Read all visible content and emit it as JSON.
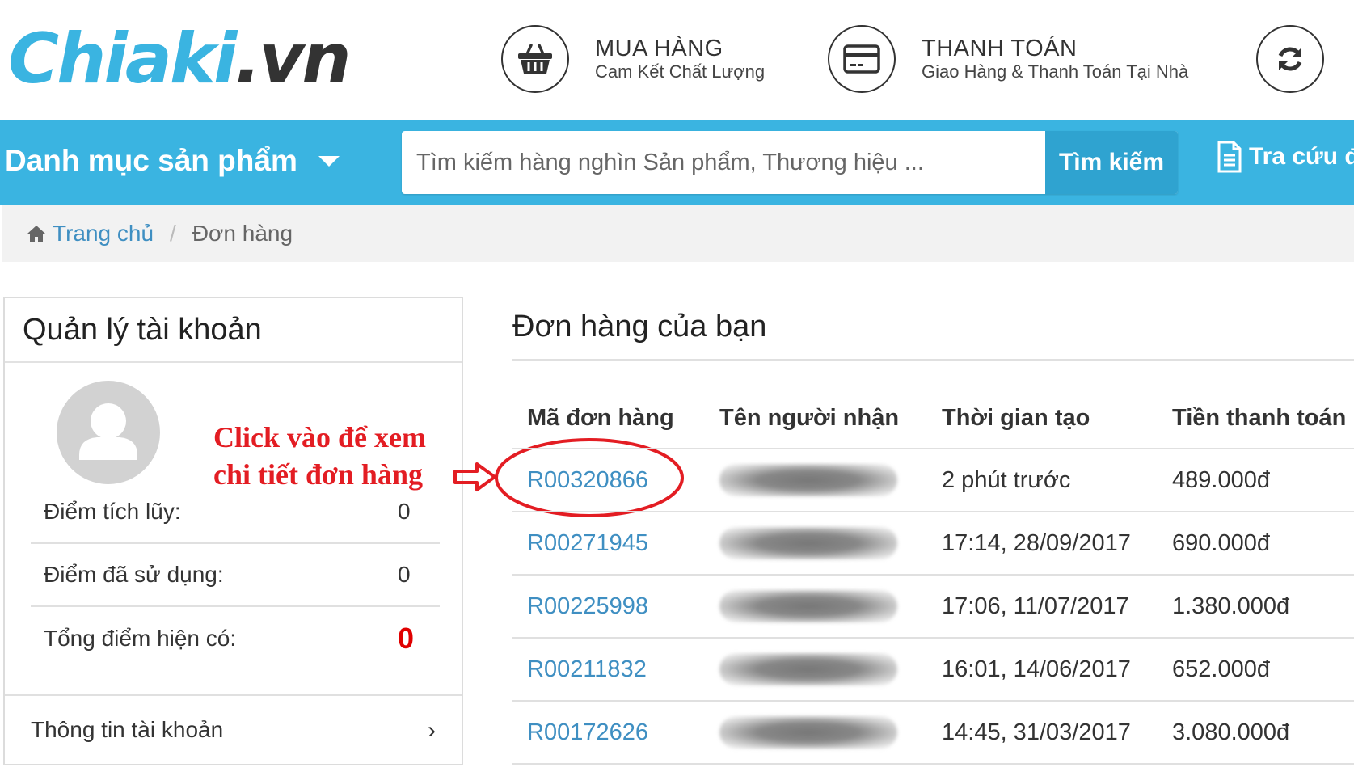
{
  "header": {
    "logo_brand": "Chiaki",
    "logo_tld": ".vn",
    "features": [
      {
        "icon": "basket-icon",
        "title": "MUA HÀNG",
        "subtitle": "Cam Kết Chất Lượng"
      },
      {
        "icon": "credit-card-icon",
        "title": "THANH TOÁN",
        "subtitle": "Giao Hàng & Thanh Toán Tại Nhà"
      },
      {
        "icon": "refresh-icon"
      }
    ]
  },
  "navbar": {
    "category_label": "Danh mục sản phẩm",
    "search_placeholder": "Tìm kiếm hàng nghìn Sản phẩm, Thương hiệu ...",
    "search_button": "Tìm kiếm",
    "tracuu_label": "Tra cứu đ"
  },
  "breadcrumb": {
    "home": "Trang chủ",
    "separator": "/",
    "current": "Đơn hàng"
  },
  "sidebar": {
    "title": "Quản lý tài khoản",
    "stats": [
      {
        "label": "Điểm tích lũy:",
        "value": "0"
      },
      {
        "label": "Điểm đã sử dụng:",
        "value": "0"
      },
      {
        "label": "Tổng điểm hiện có:",
        "value": "0"
      }
    ],
    "account_link": "Thông tin tài khoản",
    "account_chevron": "›"
  },
  "annotation": {
    "line1": "Click vào để xem",
    "line2": "chi tiết đơn hàng",
    "color": "#e31d23"
  },
  "orders": {
    "title": "Đơn hàng của bạn",
    "columns": [
      "Mã đơn hàng",
      "Tên người nhận",
      "Thời gian tạo",
      "Tiền thanh toán"
    ],
    "rows": [
      {
        "code": "R00320866",
        "time": "2 phút trước",
        "amount": "489.000đ"
      },
      {
        "code": "R00271945",
        "time": "17:14, 28/09/2017",
        "amount": "690.000đ"
      },
      {
        "code": "R00225998",
        "time": "17:06, 11/07/2017",
        "amount": "1.380.000đ"
      },
      {
        "code": "R00211832",
        "time": "16:01, 14/06/2017",
        "amount": "652.000đ"
      },
      {
        "code": "R00172626",
        "time": "14:45, 31/03/2017",
        "amount": "3.080.000đ"
      }
    ]
  },
  "colors": {
    "brand_blue": "#3ab4e1",
    "search_button": "#2fa3d0",
    "link_blue": "#3f8fc2",
    "points_red": "#e00000"
  }
}
